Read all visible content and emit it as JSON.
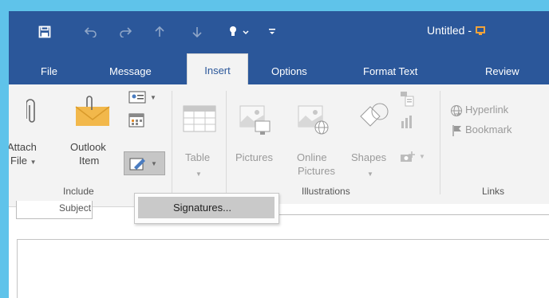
{
  "window": {
    "title": "Untitled - "
  },
  "quick_access": {
    "save_icon": "save-icon",
    "undo_icon": "undo-icon",
    "redo_icon": "redo-icon",
    "up_icon": "arrow-up-icon",
    "down_icon": "arrow-down-icon",
    "touch_mode_icon": "touch-mode-icon",
    "customize_icon": "customize-qat-icon"
  },
  "tabs": {
    "file": "File",
    "message": "Message",
    "insert": "Insert",
    "options": "Options",
    "format_text": "Format Text",
    "review": "Review"
  },
  "ribbon": {
    "attach_file": [
      "Attach",
      "File"
    ],
    "outlook_item": [
      "Outlook",
      "Item"
    ],
    "include_group": "Include",
    "table": "Table",
    "pictures": "Pictures",
    "online_pictures": [
      "Online",
      "Pictures"
    ],
    "shapes": "Shapes",
    "illustrations_group": "Illustrations",
    "hyperlink": "Hyperlink",
    "bookmark": "Bookmark",
    "links_group": "Links"
  },
  "signature_menu": {
    "item": "Signatures..."
  },
  "compose": {
    "subject_label": "Subject"
  },
  "colors": {
    "accent": "#2b579a",
    "backdrop": "#5fc3ea",
    "ribbon": "#f3f3f3"
  }
}
